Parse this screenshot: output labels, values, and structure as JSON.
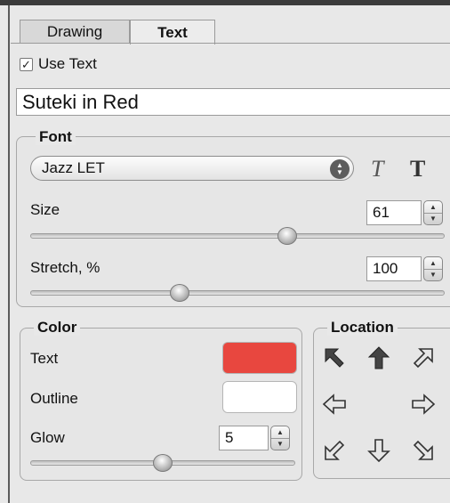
{
  "tabs": [
    {
      "label": "Drawing",
      "active": false
    },
    {
      "label": "Text",
      "active": true
    }
  ],
  "use_text": {
    "checked": true,
    "label": "Use Text"
  },
  "text_value": "Suteki in Red",
  "font": {
    "legend": "Font",
    "family": "Jazz LET",
    "italic_icon": "italic-style-icon",
    "bold_icon": "bold-style-icon",
    "size_label": "Size",
    "size_value": "61",
    "size_fraction": 0.62,
    "stretch_label": "Stretch, %",
    "stretch_value": "100",
    "stretch_fraction": 0.36
  },
  "color": {
    "legend": "Color",
    "text_label": "Text",
    "text_color": "#e8473f",
    "outline_label": "Outline",
    "outline_color": "#ffffff",
    "glow_label": "Glow",
    "glow_value": "5",
    "glow_fraction": 0.5
  },
  "location": {
    "legend": "Location",
    "buttons": [
      {
        "name": "top-left",
        "icon": "arrow-up-left-icon",
        "selected": true
      },
      {
        "name": "top",
        "icon": "arrow-up-icon",
        "selected": true
      },
      {
        "name": "top-right",
        "icon": "arrow-up-right-icon",
        "selected": false
      },
      {
        "name": "left",
        "icon": "arrow-left-icon",
        "selected": false
      },
      {
        "name": "right",
        "icon": "arrow-right-icon",
        "selected": false
      },
      {
        "name": "bottom-left",
        "icon": "arrow-down-left-icon",
        "selected": false
      },
      {
        "name": "bottom",
        "icon": "arrow-down-icon",
        "selected": false
      },
      {
        "name": "bottom-right",
        "icon": "arrow-down-right-icon",
        "selected": false
      }
    ]
  }
}
